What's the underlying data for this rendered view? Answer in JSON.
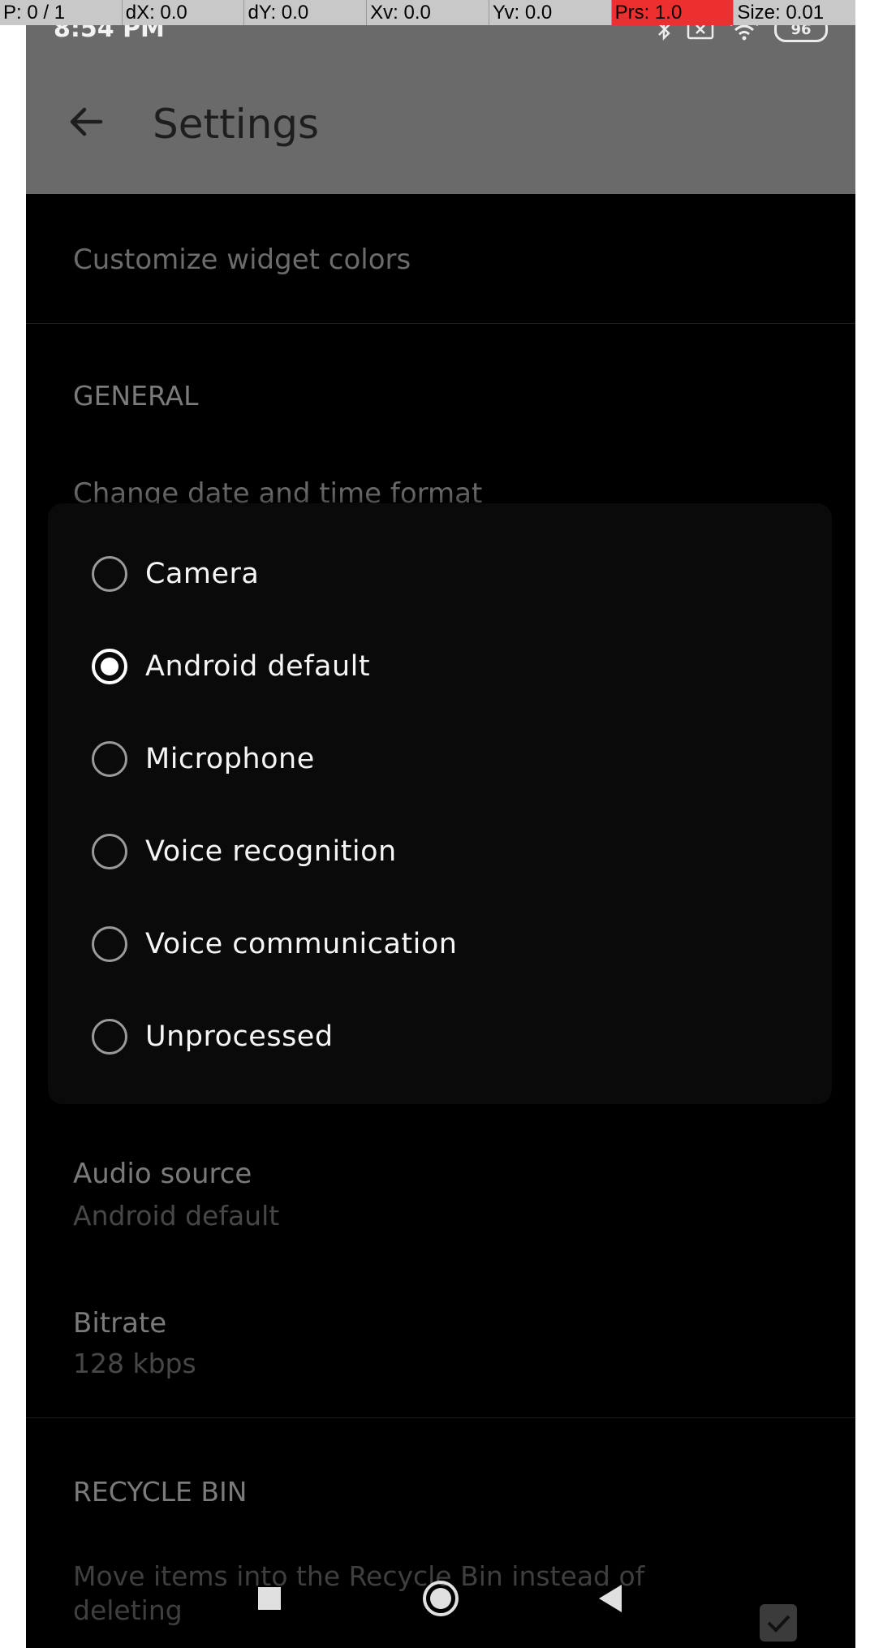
{
  "overlay": {
    "p": "P: 0 / 1",
    "dx": "dX: 0.0",
    "dy": "dY: 0.0",
    "xv": "Xv: 0.0",
    "yv": "Yv: 0.0",
    "prs": "Prs: 1.0",
    "size": "Size: 0.01"
  },
  "status_bar": {
    "time": "8:54 PM",
    "battery": "96",
    "icons": [
      "bluetooth-icon",
      "sim-off-icon",
      "wifi-icon",
      "battery-icon"
    ]
  },
  "appbar": {
    "title": "Settings",
    "back_icon": "arrow-left-icon"
  },
  "settings": {
    "customize_widget_colors": "Customize widget colors",
    "general_section": "GENERAL",
    "change_date_time": "Change date and time format",
    "audio_source_title": "Audio source",
    "audio_source_value": "Android default",
    "bitrate_title": "Bitrate",
    "bitrate_value": "128 kbps",
    "recycle_bin_section": "RECYCLE BIN",
    "move_to_recycle_line1": "Move items into the Recycle Bin instead of",
    "move_to_recycle_line2": "deleting"
  },
  "dialog": {
    "selected_index": 1,
    "options": [
      {
        "label": "Camera"
      },
      {
        "label": "Android default"
      },
      {
        "label": "Microphone"
      },
      {
        "label": "Voice recognition"
      },
      {
        "label": "Voice communication"
      },
      {
        "label": "Unprocessed"
      }
    ]
  },
  "navbar": {
    "icons": [
      "recents-square-icon",
      "home-circle-icon",
      "back-triangle-icon"
    ]
  },
  "colors": {
    "overlay_alert": "#ee2f2f",
    "dialog_bg": "#0a0a0a",
    "appbar_dimmed": "#6a6a6a"
  }
}
